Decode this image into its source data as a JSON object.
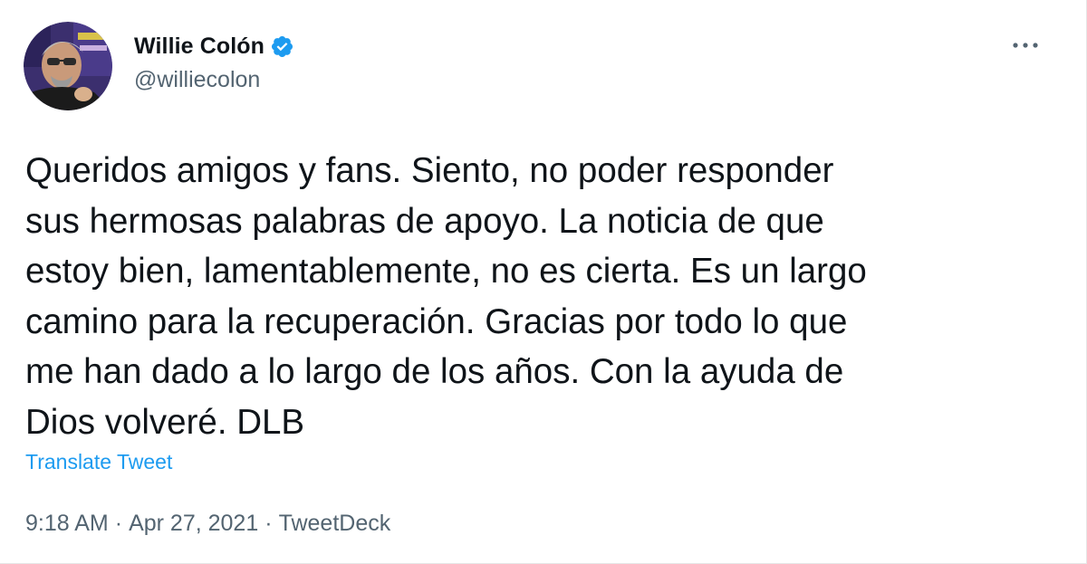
{
  "author": {
    "display_name": "Willie Colón",
    "handle": "@williecolon",
    "verified": true,
    "verified_icon": "verified-badge-icon",
    "avatar_icon": "profile-photo"
  },
  "tweet": {
    "text": "Queridos amigos y fans. Siento, no poder responder\nsus hermosas palabras de apoyo. La noticia de que\nestoy bien, lamentablemente, no es cierta. Es un largo\ncamino para la recuperación. Gracias por todo lo que\nme han dado a lo largo de los años. Con la ayuda de\nDios volveré. DLB",
    "translate_label": "Translate Tweet",
    "time": "9:18 AM",
    "separator": "·",
    "date": "Apr 27, 2021",
    "source": "TweetDeck"
  },
  "actions": {
    "more_icon": "more-options-icon"
  },
  "colors": {
    "text_primary": "#0f1419",
    "text_secondary": "#536471",
    "link": "#1d9bf0",
    "verified": "#1d9bf0"
  }
}
